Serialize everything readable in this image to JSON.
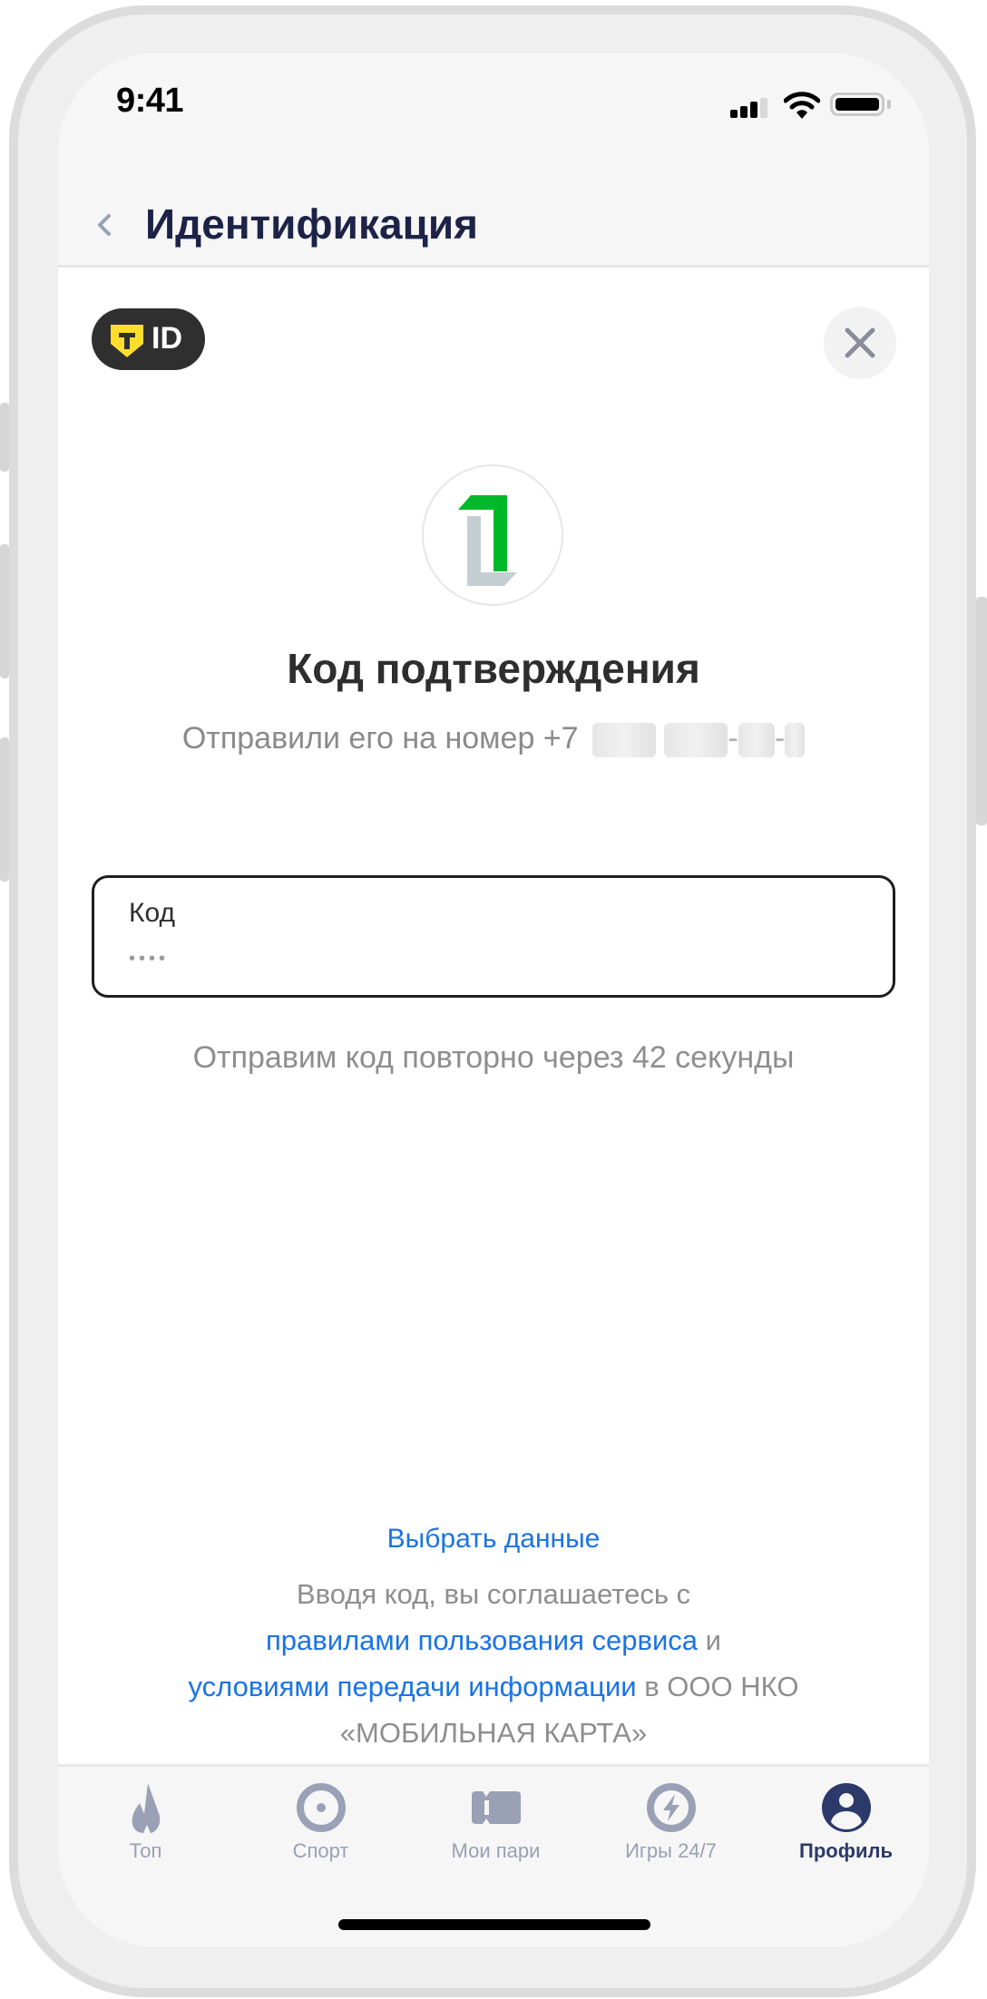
{
  "status_bar": {
    "time": "9:41",
    "signal_bars_filled": 3,
    "signal_bars_total": 4,
    "wifi_icon": "wifi-icon",
    "battery_icon": "battery-full-icon"
  },
  "header": {
    "back_icon": "chevron-left-icon",
    "title": "Идентификация"
  },
  "badge": {
    "shield_letter": "T",
    "text": "ID",
    "colors": {
      "background": "#2f2f2f",
      "shield": "#ffdd2d"
    }
  },
  "close_icon": "close-icon",
  "logo_icon": "bank-logo-icon",
  "main": {
    "heading": "Код подтверждения",
    "sent_to_prefix": "Отправили его на номер +7",
    "phone_masked": true,
    "code_field": {
      "label": "Код",
      "placeholder": "••••",
      "value": ""
    },
    "resend_text": "Отправим код повторно через 42 секунды"
  },
  "footer": {
    "choose_data_link": "Выбрать данные",
    "legal": {
      "line1": "Вводя код, вы соглашаетесь с",
      "link_rules": "правилами пользования сервиса",
      "and": " и",
      "link_conditions": "условиями передачи информации",
      "org": " в ООО НКО",
      "org_name": "«МОБИЛЬНАЯ КАРТА»"
    }
  },
  "tabbar": {
    "items": [
      {
        "label": "Топ",
        "icon": "flame-icon",
        "active": false
      },
      {
        "label": "Спорт",
        "icon": "target-icon",
        "active": false
      },
      {
        "label": "Мои пари",
        "icon": "ticket-icon",
        "active": false
      },
      {
        "label": "Игры 24/7",
        "icon": "lightning-icon",
        "active": false
      },
      {
        "label": "Профиль",
        "icon": "profile-icon",
        "active": true
      }
    ],
    "colors": {
      "inactive": "#9aa0b5",
      "active": "#2b3a6a"
    }
  },
  "colors": {
    "link": "#1a73e8",
    "title": "#1c2347",
    "logo_green": "#00b92b",
    "logo_gray": "#c5cfd3"
  }
}
